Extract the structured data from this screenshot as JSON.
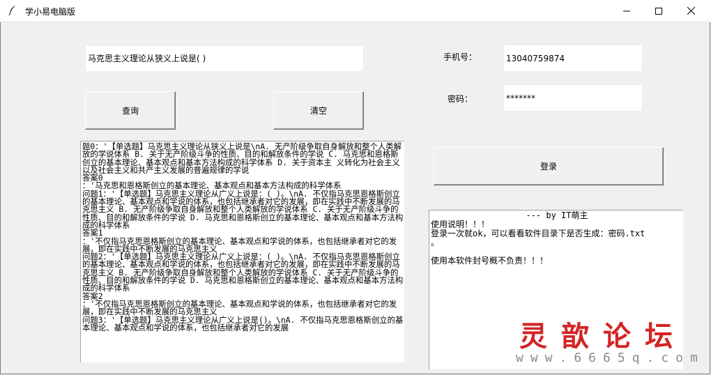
{
  "window": {
    "title": "学小易电脑版"
  },
  "query": {
    "question_value": "马克思主义理论从狭义上说是( )",
    "search_button": "查询",
    "clear_button": "清空"
  },
  "login": {
    "phone_label": "手机号：",
    "phone_value": "13040759874",
    "password_label": "密码：",
    "password_value": "*******",
    "login_button": "登录"
  },
  "results": {
    "text": "题0：'【单选题】马克思主义理论从狭义上说是\\nA. 无产阶级争取自身解放和整个人类解放的学说体系 B. 关于无产阶级斗争的性质、目的和解放条件的学说 C. 马克思和恩格斯创立的基本理论、基本观点和基本方法构成的科学体系 D. 关于资本主 义转化为社会主义以及社会主义和共产主义发展的普遍规律的学说\n答案0\n：'马克思和恩格斯创立的基本理论、基本观点和基本方法构成的科学体系\n问题1：'【单选题】马克思主义理论从广义上说是：( )。\\nA. 不仅指马克思恩格斯创立的基本理论、基本观点和学说的体系，也包括继承者对它的发展，即在实践中不断发展的马克思主义 B. 无产阶级争取自身解放和整个人类解放的学说体系 C. 关于无产阶级斗争的性质、目的和解放条件的学说 D. 马克思和恩格斯创立的基本理论、基本观点和基本方法构成的科学体系\n答案1\n：'不仅指马克思恩格斯创立的基本理论、基本观点和学说的体系，也包括继承者对它的发展，即在实践中不断发展的马克思主义\n问题2：'【单选题】马克思主义理论从广义上说是：( )。\\nA. 不仅指马克思恩格斯创立的基本理论、基本观点和学说的体系，也包括继承者对它的发展，即在实践中不断发展的马克思主义 B. 无产阶级争取自身解放和整个人类解放的学说体系 C. 关于无产阶级斗争的性质、目的和解放条件的学说 D. 马克思和恩格斯创立的基本理论、基本观点和基本方法构成的科学体系\n答案2\n：'不仅指马克思恩格斯创立的基本理论、基本观点和学说的体系，也包括继承者对它的发展，即在实践中不断发展的马克思主义\n问题3：'【单选题】马克思主义理论从广义上说是()。\\nA. 不仅指马克思恩格斯创立的基本理论、基本观点和学说的体系，也包括继承者对它的发展"
  },
  "info": {
    "header": "--- by IT萌主",
    "body": "使用说明！！！\n登录一次就ok，可以看看软件目录下是否生成：密码.txt\n。\n\n使用本软件封号概不负责！！！"
  },
  "watermark": {
    "title": "灵歆论坛",
    "url": "www.6665q.com"
  }
}
